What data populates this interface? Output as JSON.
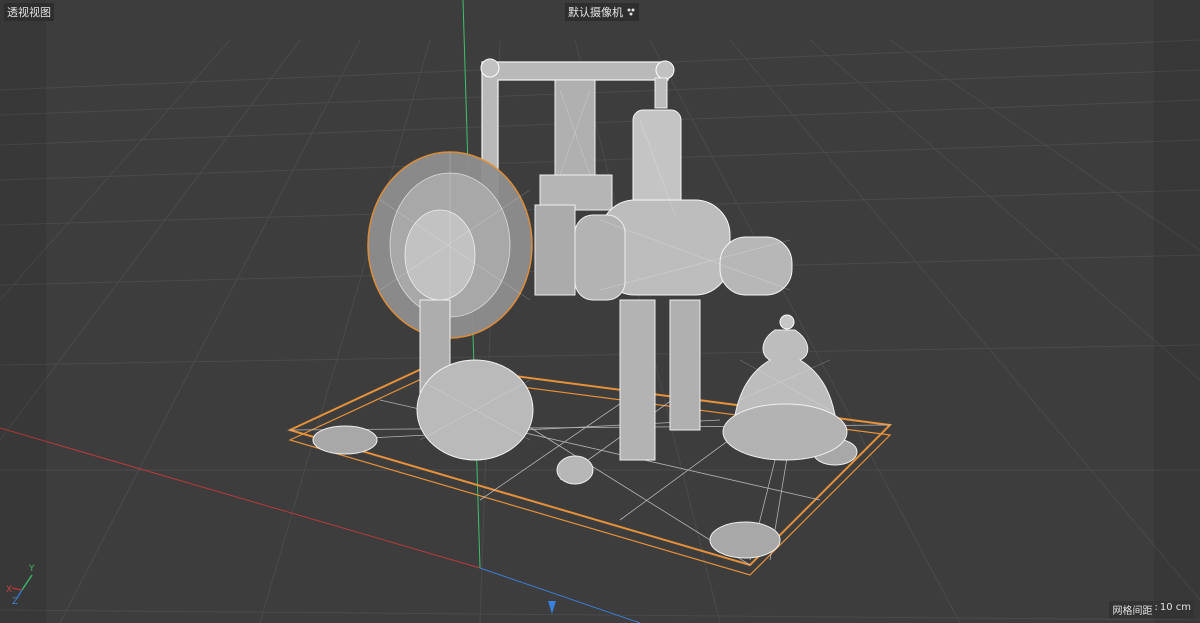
{
  "viewport": {
    "view_name": "透视视图",
    "camera_name": "默认摄像机",
    "grid_spacing_label": "网格间距",
    "grid_spacing_value": "10 cm"
  },
  "axis_gizmo": {
    "x_label": "X",
    "y_label": "Y",
    "z_label": "Z"
  },
  "colors": {
    "background": "#3d3d3d",
    "grid_line": "#4a4a4a",
    "wireframe": "#dcdcdc",
    "selection_outline": "#e6913a",
    "x_axis": "#b83a3a",
    "y_axis": "#3fbf6a",
    "z_axis": "#3a7fd9"
  }
}
